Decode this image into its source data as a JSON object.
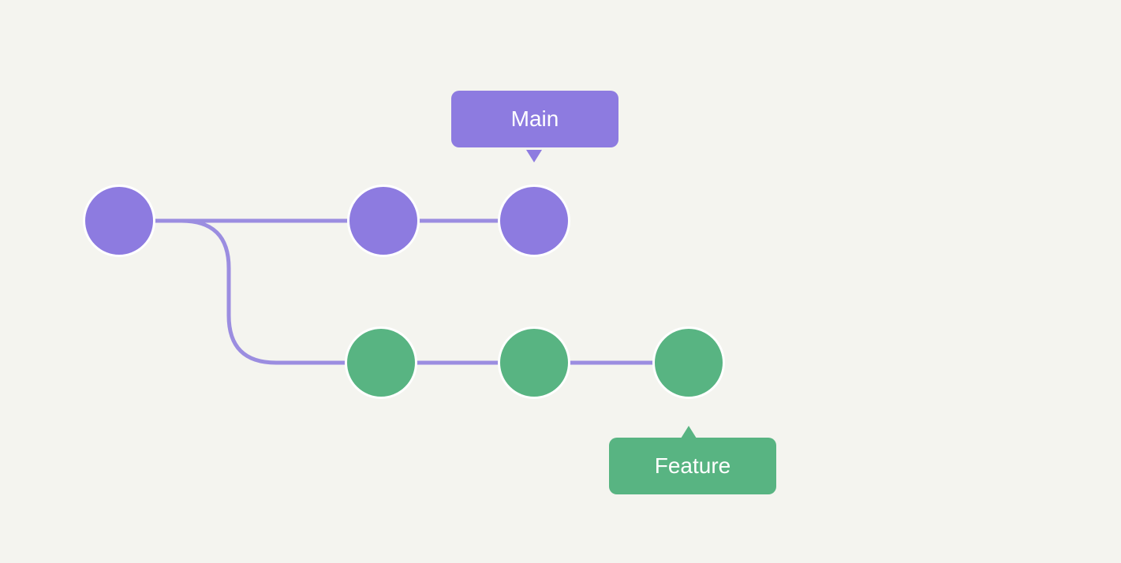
{
  "colors": {
    "purple": "#8d7be0",
    "green": "#58b482",
    "background": "#f4f4ef",
    "connector": "#9b8de0"
  },
  "branches": {
    "main": {
      "label": "Main",
      "color": "purple",
      "commits": 3
    },
    "feature": {
      "label": "Feature",
      "color": "green",
      "commits": 3
    }
  }
}
